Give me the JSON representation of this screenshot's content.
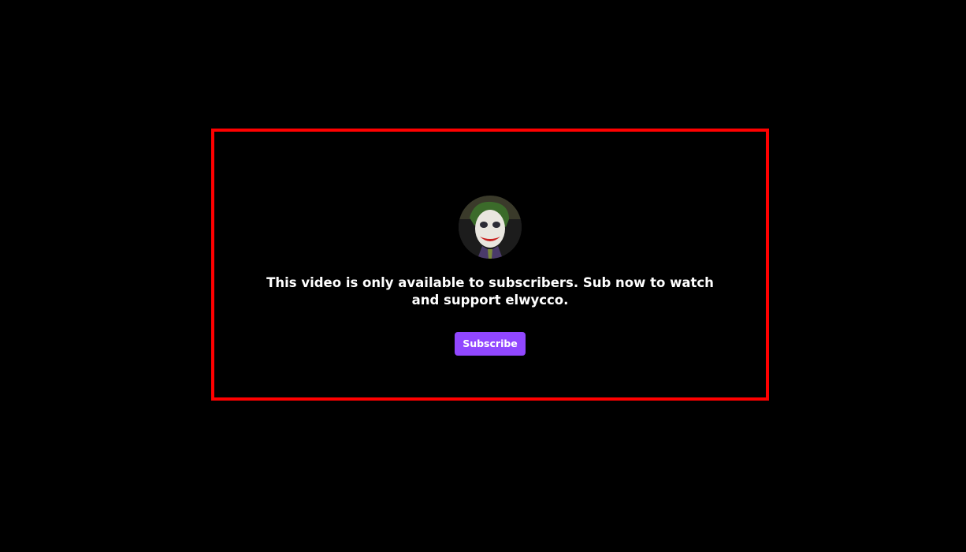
{
  "avatar": {
    "icon": "channel-avatar"
  },
  "gate": {
    "message": "This video is only available to subscribers. Sub now to watch and support elwycco.",
    "subscribe_label": "Subscribe"
  },
  "colors": {
    "background": "#000000",
    "highlight_frame": "#ff0000",
    "subscribe_button": "#9147ff",
    "text": "#ffffff"
  }
}
